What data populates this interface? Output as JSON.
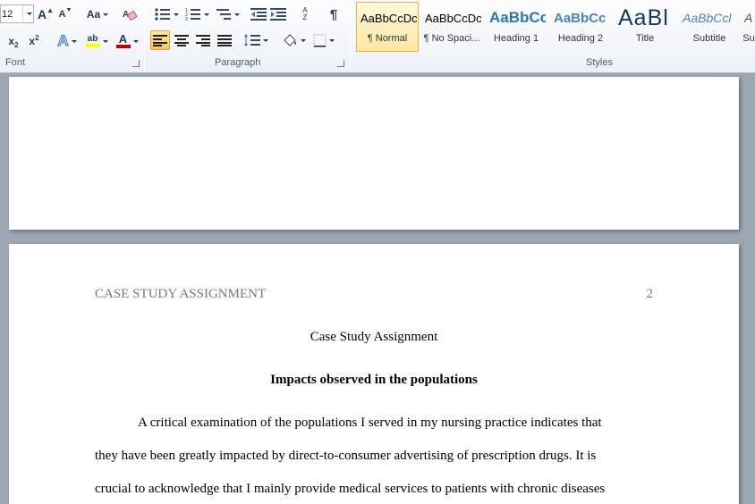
{
  "ribbon": {
    "font": {
      "size": "12",
      "group_label": "Font",
      "grow_label": "A",
      "shrink_label": "A",
      "case_label": "Aa",
      "subscript_label": "x",
      "superscript_label": "x",
      "text_effects_label": "A",
      "highlight_label": "ab",
      "font_color_label": "A",
      "font_color": "#c00000",
      "highlight_color": "#ffff00"
    },
    "paragraph": {
      "group_label": "Paragraph",
      "pilcrow": "¶",
      "sort_label": "A Z"
    },
    "styles": {
      "group_label": "Styles",
      "items": [
        {
          "preview": "AaBbCcDc",
          "name": "¶ Normal",
          "color": "#000000"
        },
        {
          "preview": "AaBbCcDc",
          "name": "¶ No Spaci...",
          "color": "#000000"
        },
        {
          "preview": "AaBbCc",
          "name": "Heading 1",
          "color": "#2e74b5"
        },
        {
          "preview": "AaBbCc",
          "name": "Heading 2",
          "color": "#4f81bd"
        },
        {
          "preview": "AaBl",
          "name": "Title",
          "color": "#17365d"
        },
        {
          "preview": "AaBbCcl",
          "name": "Subtitle",
          "color": "#4f81bd"
        },
        {
          "preview": "A",
          "name": "Su",
          "color": "#555555"
        }
      ]
    }
  },
  "document": {
    "header": "CASE STUDY ASSIGNMENT",
    "page_number": "2",
    "title": "Case Study Assignment",
    "heading": "Impacts observed in the populations",
    "lines": [
      "A critical examination of the populations I served in my nursing practice indicates that",
      "they have been greatly impacted by direct-to-consumer advertising of prescription drugs. It is",
      "crucial to acknowledge that I mainly provide medical services to patients with chronic diseases"
    ]
  }
}
